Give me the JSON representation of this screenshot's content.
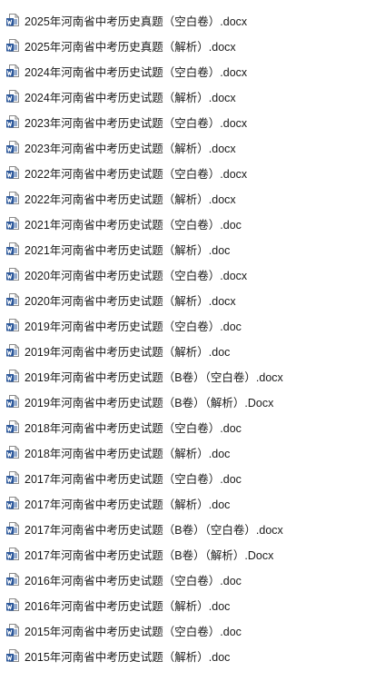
{
  "files": [
    {
      "name": "2025年河南省中考历史真题（空白卷）.docx",
      "icon": "word-doc-icon"
    },
    {
      "name": "2025年河南省中考历史真题（解析）.docx",
      "icon": "word-doc-icon"
    },
    {
      "name": "2024年河南省中考历史试题（空白卷）.docx",
      "icon": "word-doc-icon"
    },
    {
      "name": "2024年河南省中考历史试题（解析）.docx",
      "icon": "word-doc-icon"
    },
    {
      "name": "2023年河南省中考历史试题（空白卷）.docx",
      "icon": "word-doc-icon"
    },
    {
      "name": "2023年河南省中考历史试题（解析）.docx",
      "icon": "word-doc-icon"
    },
    {
      "name": "2022年河南省中考历史试题（空白卷）.docx",
      "icon": "word-doc-icon"
    },
    {
      "name": "2022年河南省中考历史试题（解析）.docx",
      "icon": "word-doc-icon"
    },
    {
      "name": "2021年河南省中考历史试题（空白卷）.doc",
      "icon": "word-doc-icon"
    },
    {
      "name": "2021年河南省中考历史试题（解析）.doc",
      "icon": "word-doc-icon"
    },
    {
      "name": "2020年河南省中考历史试题（空白卷）.docx",
      "icon": "word-doc-icon"
    },
    {
      "name": "2020年河南省中考历史试题（解析）.docx",
      "icon": "word-doc-icon"
    },
    {
      "name": "2019年河南省中考历史试题（空白卷）.doc",
      "icon": "word-doc-icon"
    },
    {
      "name": "2019年河南省中考历史试题（解析）.doc",
      "icon": "word-doc-icon"
    },
    {
      "name": "2019年河南省中考历史试题（B卷）（空白卷）.docx",
      "icon": "word-doc-icon"
    },
    {
      "name": "2019年河南省中考历史试题（B卷）（解析）.Docx",
      "icon": "word-doc-icon"
    },
    {
      "name": "2018年河南省中考历史试题（空白卷）.doc",
      "icon": "word-doc-icon"
    },
    {
      "name": "2018年河南省中考历史试题（解析）.doc",
      "icon": "word-doc-icon"
    },
    {
      "name": "2017年河南省中考历史试题（空白卷）.doc",
      "icon": "word-doc-icon"
    },
    {
      "name": "2017年河南省中考历史试题（解析）.doc",
      "icon": "word-doc-icon"
    },
    {
      "name": "2017年河南省中考历史试题（B卷）（空白卷）.docx",
      "icon": "word-doc-icon"
    },
    {
      "name": "2017年河南省中考历史试题（B卷）（解析）.Docx",
      "icon": "word-doc-icon"
    },
    {
      "name": "2016年河南省中考历史试题（空白卷）.doc",
      "icon": "word-doc-icon"
    },
    {
      "name": "2016年河南省中考历史试题（解析）.doc",
      "icon": "word-doc-icon"
    },
    {
      "name": "2015年河南省中考历史试题（空白卷）.doc",
      "icon": "word-doc-icon"
    },
    {
      "name": "2015年河南省中考历史试题（解析）.doc",
      "icon": "word-doc-icon"
    }
  ],
  "colors": {
    "icon_blue": "#2b579a",
    "icon_page": "#ffffff",
    "icon_outline": "#8a8a8a",
    "text": "#1a1a1a"
  }
}
